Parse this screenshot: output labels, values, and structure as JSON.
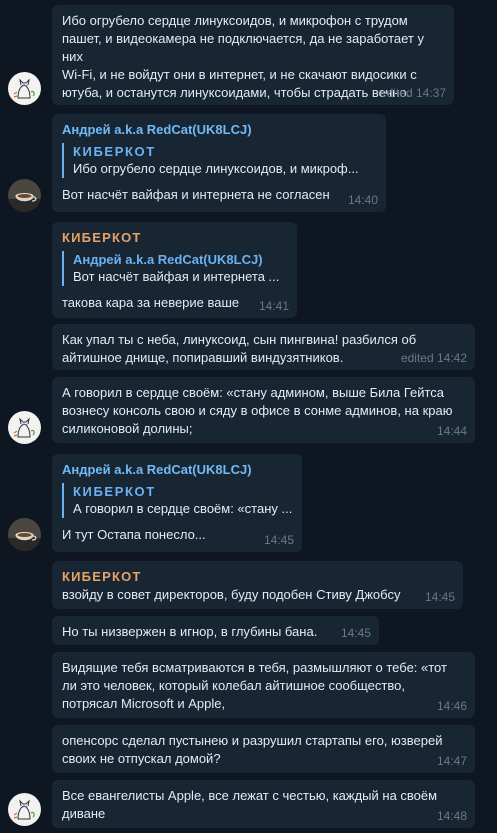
{
  "messages": [
    {
      "text": "Ибо огрубело сердце линуксоидов, и микрофон с трудом\nпашет, и видеокамера не подключается, да не заработает у них\nWi-Fi, и не войдут они в интернет, и не скачают видосики с\nютуба, и останутся линуксоидами, чтобы страдать вечно.",
      "time": "edited 14:37"
    },
    {
      "sender": "Андрей a.k.a RedCat(UK8LCJ)",
      "reply_name": "КИБЕРКОТ",
      "reply_text": "Ибо огрубело сердце линуксоидов, и микроф...",
      "text": "Вот насчёт вайфая и интернета не согласен",
      "time": "14:40"
    },
    {
      "sender": "КИБЕРКОТ",
      "reply_name": "Андрей a.k.a RedCat(UK8LCJ)",
      "reply_text": "Вот насчёт вайфая и интернета ...",
      "text": "такова кара за неверие ваше",
      "time": "14:41"
    },
    {
      "text": "Как упал ты с неба, линуксоид, сын пингвина! разбился об\nайтишное днище, попиравший виндузятников.",
      "time": "edited 14:42"
    },
    {
      "text": "А говорил в сердце своём: «стану админом, выше Била Гейтса\nвознесу консоль свою и сяду в офисе в сонме админов, на краю\nсиликоновой долины;",
      "time": "14:44"
    },
    {
      "sender": "Андрей a.k.a RedCat(UK8LCJ)",
      "reply_name": "КИБЕРКОТ",
      "reply_text": "А говорил в сердце своём: «стану ...",
      "text": "И тут Остапа понесло...",
      "time": "14:45"
    },
    {
      "sender": "КИБЕРКОТ",
      "text": "взойду в совет директоров, буду подобен Стиву Джобсу",
      "time": "14:45"
    },
    {
      "text": "Но ты низвержен в игнор, в глубины бана.",
      "time": "14:45"
    },
    {
      "text": "Видящие тебя всматриваются в тебя, размышляют о тебе: «тот\nли это человек, который колебал айтишное сообщество,\nпотрясал Microsoft и Apple,",
      "time": "14:46"
    },
    {
      "text": "опенсорс сделал пустынею и разрушил стартапы его, юзверей\nсвоих не отпускал домой?",
      "time": "14:47"
    },
    {
      "text": "Все евангелисты Apple, все лежат с честью, каждый на своём\nдиване",
      "time": "14:48"
    }
  ],
  "avatars": {
    "kiberkot": "cat-sketch-avatar",
    "andrey": "teacup-photo-avatar"
  },
  "colors": {
    "background": "#0e1621",
    "bubble": "#182533",
    "sender_blue": "#71baf6",
    "sender_orange": "#e8a264",
    "reply_bar": "#6ab2f2",
    "time": "#6c7883"
  }
}
